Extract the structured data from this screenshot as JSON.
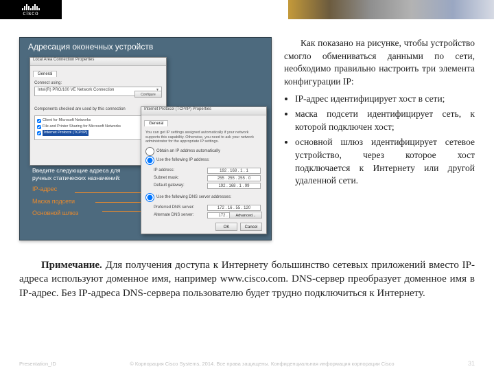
{
  "brand": {
    "name": "cisco"
  },
  "shot": {
    "title": "Адресация оконечных устройств",
    "win1": {
      "title": "Local Area Connection Properties",
      "tab": "General",
      "connect_label": "Connect using:",
      "nic": "Intel(R) PRO/100 VE Network Connection",
      "configure_btn": "Configure",
      "checked_label": "Components checked are used by this connection",
      "items": {
        "client": "Client for Microsoft Networks",
        "fps": "File and Printer Sharing for Microsoft Networks",
        "tcpip": "Internet Protocol (TCP/IP)"
      }
    },
    "win2": {
      "title": "Internet Protocol (TCP/IP) Properties",
      "tab": "General",
      "blurb": "You can get IP settings assigned automatically if your network supports this capability. Otherwise, you need to ask your network administrator for the appropriate IP settings.",
      "r1": "Obtain an IP address automatically",
      "r2": "Use the following IP address:",
      "ip_label": "IP address:",
      "ip_val": "192 . 168 . 1 . 1",
      "mask_label": "Subnet mask:",
      "mask_val": "255 . 255 . 255 . 0",
      "gw_label": "Default gateway:",
      "gw_val": "192 . 168 . 1 . 99",
      "r3": "Use the following DNS server addresses:",
      "dns1_label": "Preferred DNS server:",
      "dns1_val": "172 . 16 . 55 . 120",
      "dns2_label": "Alternate DNS server:",
      "dns2_val": "172 . 16 . 55 . 30",
      "advanced_btn": "Advanced...",
      "ok": "OK",
      "cancel": "Cancel"
    },
    "callout": {
      "intro": "Введите следующие адреса для ручных статических назначений:",
      "ip": "IP-адрес",
      "mask": "Маска подсети",
      "gw": "Основной шлюз"
    }
  },
  "right": {
    "para": "Как показано на рисунке, чтобы устройство смогло обмениваться данными по сети, необходимо правильно настроить три элемента конфигурации IP:",
    "bullets": {
      "b1": "IP-адрес идентифицирует хост в сети;",
      "b2": "маска подсети идентифицирует сеть, к которой подключен хост;",
      "b3": "основной шлюз идентифицирует сетевое устройство, через которое хост подключается к Интернету или другой удаленной сети."
    }
  },
  "note": {
    "label": "Примечание.",
    "text": " Для получения доступа к Интернету большинство сетевых приложений вместо IP-адреса используют доменное имя, например www.cisco.com. DNS-сервер преобразует доменное имя в IP-адрес. Без IP-адреса DNS-сервера пользователю будет трудно подключиться к Интернету."
  },
  "footer": {
    "left": "Presentation_ID",
    "center": "© Корпорация Cisco Systems, 2014. Все права защищены. Конфиденциальная информация корпорации Cisco",
    "page": "31"
  }
}
